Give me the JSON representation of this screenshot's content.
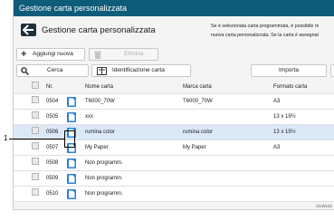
{
  "window": {
    "title": "Gestione carta personalizzata"
  },
  "header": {
    "back_icon": "arrow-left-icon",
    "title": "Gestione carta personalizzata",
    "note_line1": "Se è selezionata carta programmata, è possibile m",
    "note_line2": "nuova carta personalizzata. Se la carta è assegnat"
  },
  "toolbar": {
    "add_label": "Aggiungi nuova",
    "delete_label": "Elimina",
    "search_label": "Cerca",
    "identify_label": "Identificazione carta",
    "import_label": "Importa"
  },
  "table": {
    "columns": [
      "Nr.",
      "Nome carta",
      "Marca carta",
      "Formato carta"
    ],
    "rows": [
      {
        "num": "0504",
        "name": "T6000_70W",
        "brand": "T6000_70W",
        "format": "A3",
        "selected": false
      },
      {
        "num": "0505",
        "name": "xxx",
        "brand": "",
        "format": "13 x 19½",
        "selected": false
      },
      {
        "num": "0506",
        "name": "rumina color",
        "brand": "rumina color",
        "format": "13 x 19½",
        "selected": true
      },
      {
        "num": "0507",
        "name": "My Paper",
        "brand": "My Paper",
        "format": "A3",
        "selected": false
      },
      {
        "num": "0508",
        "name": "Non programm.",
        "brand": "",
        "format": "",
        "selected": false
      },
      {
        "num": "0509",
        "name": "Non programm.",
        "brand": "",
        "format": "",
        "selected": false
      },
      {
        "num": "0510",
        "name": "Non programm.",
        "brand": "",
        "format": "",
        "selected": false
      }
    ]
  },
  "callout": {
    "label": "1"
  },
  "figure_id": "CKW101",
  "colors": {
    "titlebar": "#0d5c7a",
    "paper_icon": "#2a7fd6",
    "selected_row": "#dbe9f7"
  }
}
